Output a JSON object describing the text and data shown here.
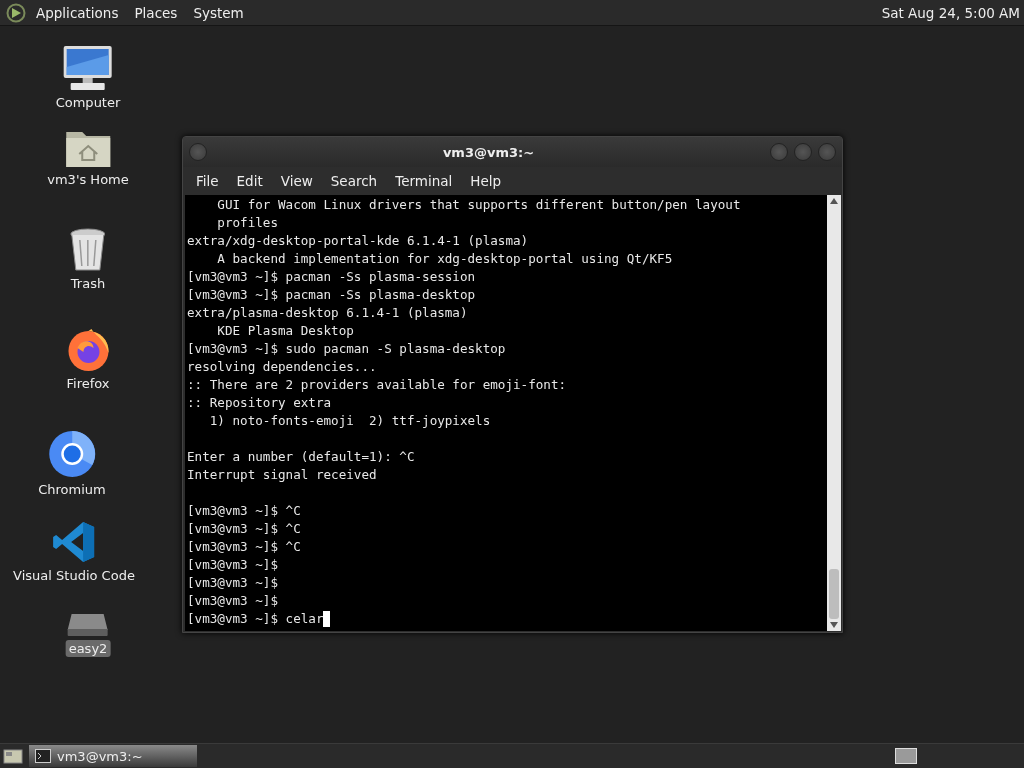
{
  "top_panel": {
    "menus": [
      "Applications",
      "Places",
      "System"
    ],
    "clock": "Sat Aug 24,  5:00 AM"
  },
  "desktop_icons": [
    {
      "kind": "computer",
      "label": "Computer",
      "selected": false
    },
    {
      "kind": "home",
      "label": "vm3's Home",
      "selected": false
    },
    {
      "kind": "trash",
      "label": "Trash",
      "selected": false
    },
    {
      "kind": "firefox",
      "label": "Firefox",
      "selected": false
    },
    {
      "kind": "chromium",
      "label": "Chromium",
      "selected": false
    },
    {
      "kind": "vscode",
      "label": "Visual Studio Code",
      "selected": false
    },
    {
      "kind": "drive",
      "label": "easy2",
      "selected": true
    }
  ],
  "terminal": {
    "title": "vm3@vm3:~",
    "menu": [
      "File",
      "Edit",
      "View",
      "Search",
      "Terminal",
      "Help"
    ],
    "blocks": [
      {
        "lines": [
          {
            "text": "    GUI for Wacom Linux drivers that supports different button/pen layout"
          },
          {
            "text": "    profiles"
          },
          {
            "text": "extra/xdg-desktop-portal-kde 6.1.4-1 (plasma)"
          },
          {
            "text": "    A backend implementation for xdg-desktop-portal using Qt/KF5"
          },
          {
            "text": "[vm3@vm3 ~]$ pacman -Ss plasma-session"
          },
          {
            "text": "[vm3@vm3 ~]$ pacman -Ss plasma-desktop"
          },
          {
            "text": "extra/plasma-desktop 6.1.4-1 (plasma)"
          },
          {
            "text": "    KDE Plasma Desktop"
          },
          {
            "text": "[vm3@vm3 ~]$ sudo pacman -S plasma-desktop"
          },
          {
            "text": "resolving dependencies..."
          },
          {
            "text": ":: There are 2 providers available for emoji-font:"
          },
          {
            "text": ":: Repository extra"
          },
          {
            "text": "   1) noto-fonts-emoji  2) ttf-joypixels"
          }
        ]
      },
      {
        "lines": [
          {
            "text": "Enter a number (default=1): ^C"
          },
          {
            "text": "Interrupt signal received"
          }
        ]
      },
      {
        "lines": [
          {
            "text": "[vm3@vm3 ~]$ ^C"
          },
          {
            "text": "[vm3@vm3 ~]$ ^C"
          },
          {
            "text": "[vm3@vm3 ~]$ ^C"
          },
          {
            "text": "[vm3@vm3 ~]$"
          },
          {
            "text": "[vm3@vm3 ~]$"
          },
          {
            "text": "[vm3@vm3 ~]$"
          },
          {
            "text": "[vm3@vm3 ~]$ celar",
            "cursor": true
          }
        ]
      }
    ]
  },
  "taskbar": {
    "tasks": [
      {
        "label": "vm3@vm3:~",
        "selected": true
      }
    ]
  }
}
